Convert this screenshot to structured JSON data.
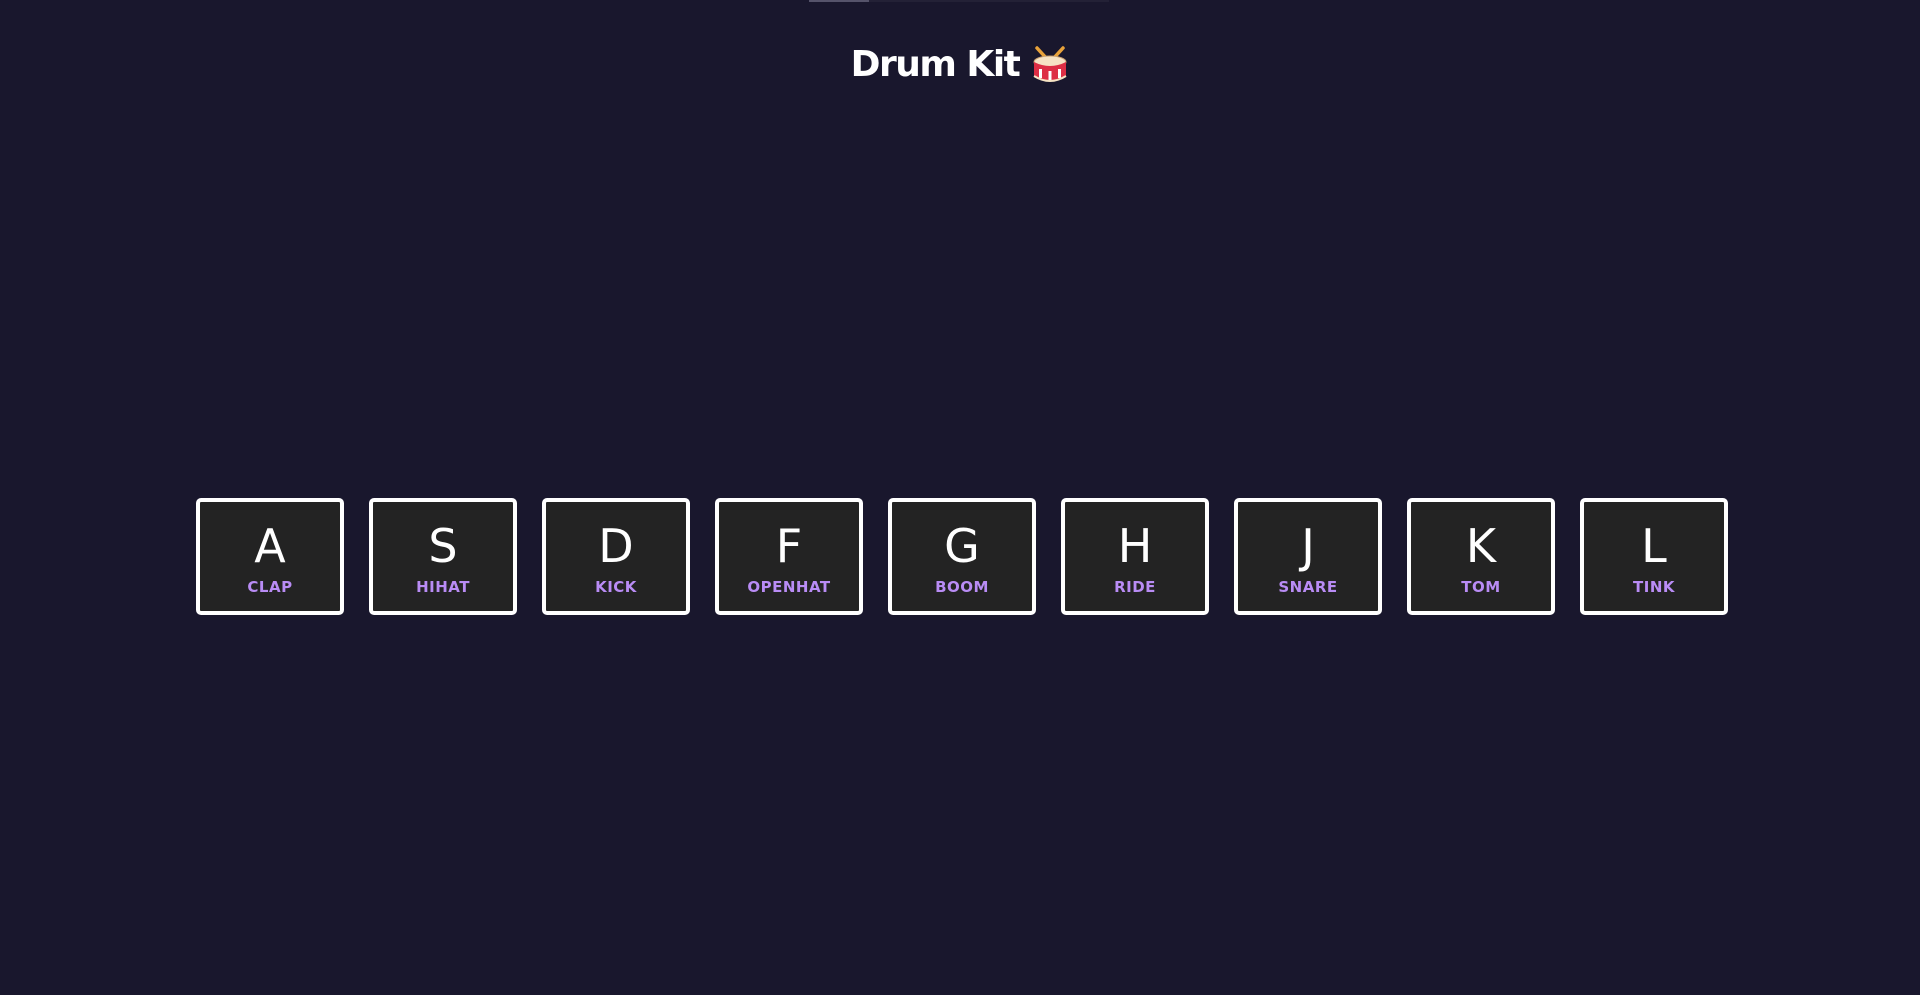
{
  "header": {
    "title": "Drum Kit",
    "icon": "drum-icon"
  },
  "colors": {
    "background": "#19172d",
    "key_background": "#232323",
    "key_border": "#ffffff",
    "sound_label": "#b98cf5"
  },
  "keys": [
    {
      "key": "A",
      "sound": "CLAP"
    },
    {
      "key": "S",
      "sound": "HIHAT"
    },
    {
      "key": "D",
      "sound": "KICK"
    },
    {
      "key": "F",
      "sound": "OPENHAT"
    },
    {
      "key": "G",
      "sound": "BOOM"
    },
    {
      "key": "H",
      "sound": "RIDE"
    },
    {
      "key": "J",
      "sound": "SNARE"
    },
    {
      "key": "K",
      "sound": "TOM"
    },
    {
      "key": "L",
      "sound": "TINK"
    }
  ]
}
